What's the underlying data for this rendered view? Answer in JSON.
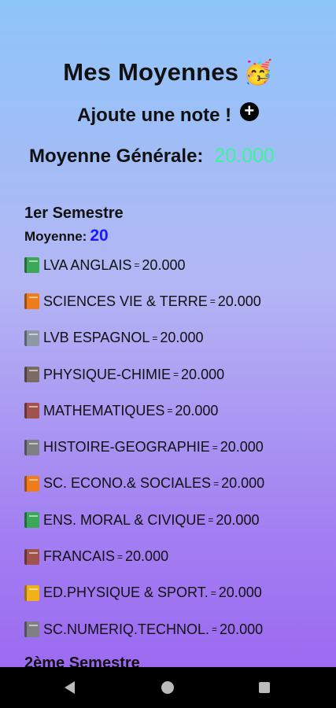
{
  "header": {
    "title": "Mes Moyennes",
    "title_emoji": "🥳"
  },
  "add_note": {
    "label": "Ajoute une note !",
    "icon": "plus-circle-icon"
  },
  "general_average": {
    "label": "Moyenne Générale:",
    "value": "20.000",
    "value_color": "#38f59a"
  },
  "semesters": [
    {
      "title": "1er Semestre",
      "average_label": "Moyenne:",
      "average_value": "20",
      "subjects": [
        {
          "name": "LVA ANGLAIS",
          "sep": "=",
          "grade": "20.000",
          "book_color": "#3aa856"
        },
        {
          "name": "SCIENCES VIE & TERRE",
          "sep": "=",
          "grade": "20.000",
          "book_color": "#f07b1a"
        },
        {
          "name": "LVB ESPAGNOL",
          "sep": "=",
          "grade": "20.000",
          "book_color": "#8c98a6"
        },
        {
          "name": "PHYSIQUE-CHIMIE",
          "sep": "=",
          "grade": "20.000",
          "book_color": "#7a6a63"
        },
        {
          "name": "MATHEMATIQUES",
          "sep": "=",
          "grade": "20.000",
          "book_color": "#a0524d"
        },
        {
          "name": "HISTOIRE-GEOGRAPHIE",
          "sep": "=",
          "grade": "20.000",
          "book_color": "#7f7f86"
        },
        {
          "name": "SC. ECONO.& SOCIALES",
          "sep": "=",
          "grade": "20.000",
          "book_color": "#f07b1a"
        },
        {
          "name": "ENS. MORAL & CIVIQUE",
          "sep": "=",
          "grade": "20.000",
          "book_color": "#3aa856"
        },
        {
          "name": "FRANCAIS",
          "sep": "=",
          "grade": "20.000",
          "book_color": "#a0524d"
        },
        {
          "name": "ED.PHYSIQUE & SPORT.",
          "sep": "=",
          "grade": "20.000",
          "book_color": "#f0b11a"
        },
        {
          "name": "SC.NUMERIQ.TECHNOL.",
          "sep": "=",
          "grade": "20.000",
          "book_color": "#7f7f86"
        }
      ]
    },
    {
      "title": "2ème Semestre"
    }
  ],
  "nav": {
    "back": "back-icon",
    "home": "home-icon",
    "recents": "recents-icon"
  }
}
